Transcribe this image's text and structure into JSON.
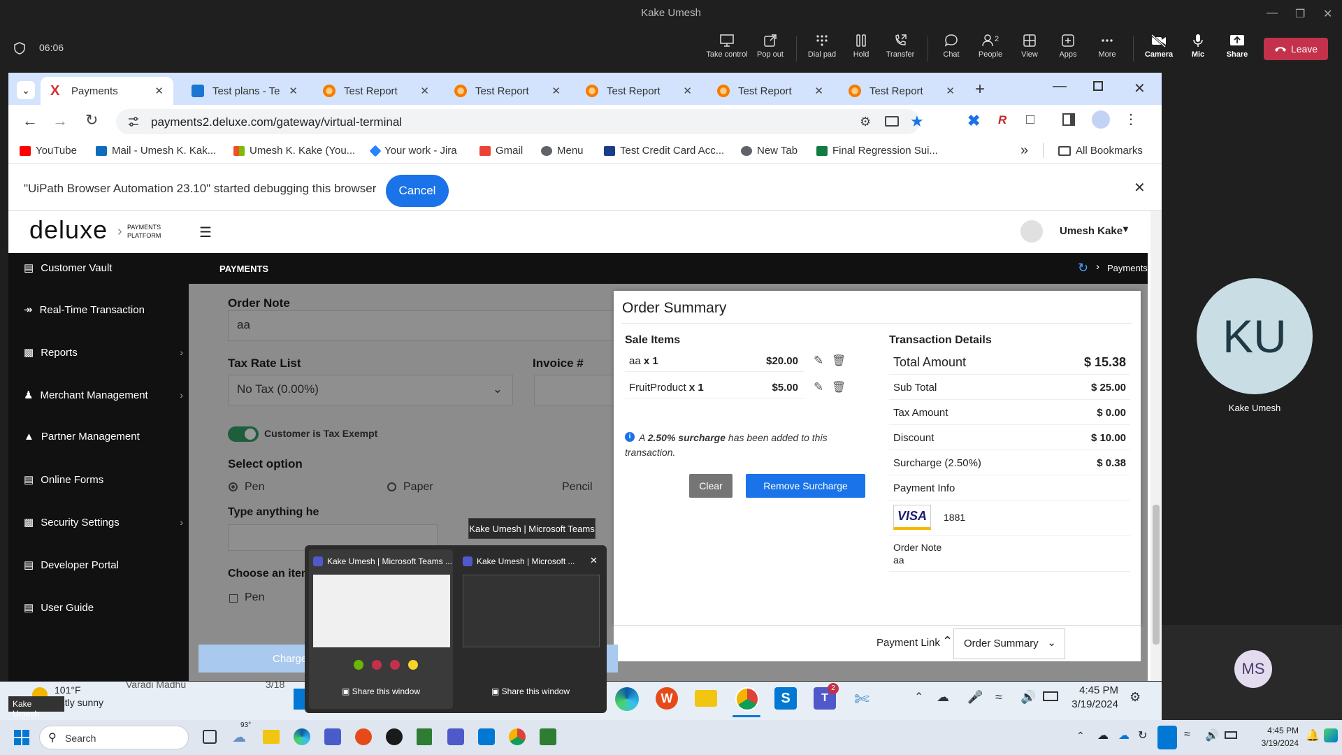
{
  "teams": {
    "window_title": "Kake Umesh",
    "timer": "06:06",
    "toolbar": [
      {
        "label": "Take control",
        "icon": "take-control-icon"
      },
      {
        "label": "Pop out",
        "icon": "pop-out-icon"
      },
      {
        "label": "Dial pad",
        "icon": "dial-pad-icon"
      },
      {
        "label": "Hold",
        "icon": "hold-icon"
      },
      {
        "label": "Transfer",
        "icon": "transfer-icon"
      },
      {
        "label": "Chat",
        "icon": "chat-icon"
      },
      {
        "label": "People",
        "icon": "people-icon"
      },
      {
        "label": "View",
        "icon": "view-icon"
      },
      {
        "label": "Apps",
        "icon": "apps-icon"
      },
      {
        "label": "More",
        "icon": "more-icon"
      },
      {
        "label": "Camera",
        "icon": "camera-off-icon"
      },
      {
        "label": "Mic",
        "icon": "mic-icon"
      },
      {
        "label": "Share",
        "icon": "share-icon"
      }
    ],
    "people_count": "2",
    "leave_label": "Leave",
    "participant_initials": "KU",
    "participant_name": "Kake Umesh",
    "participant2_initials": "MS",
    "presenter_name_tag": "Kake Umesh"
  },
  "browser": {
    "tabs": [
      {
        "title": "Payments"
      },
      {
        "title": "Test plans - Te"
      },
      {
        "title": "Test Report"
      },
      {
        "title": "Test Report"
      },
      {
        "title": "Test Report"
      },
      {
        "title": "Test Report"
      },
      {
        "title": "Test Report"
      }
    ],
    "url": "payments2.deluxe.com/gateway/virtual-terminal",
    "bookmarks": [
      {
        "label": "YouTube",
        "color": "#ff0000"
      },
      {
        "label": "Mail - Umesh K. Kak...",
        "color": "#0f6cbd"
      },
      {
        "label": "Umesh K. Kake (You...",
        "color": "#f25022"
      },
      {
        "label": "Your work - Jira",
        "color": "#2684ff"
      },
      {
        "label": "Gmail",
        "color": "#ea4335"
      },
      {
        "label": "Menu",
        "color": "#5f6368"
      },
      {
        "label": "Test Credit Card Acc...",
        "color": "#1a3c8a"
      },
      {
        "label": "New Tab",
        "color": "#5f6368"
      },
      {
        "label": "Final Regression Sui...",
        "color": "#107c41"
      }
    ],
    "all_bookmarks_label": "All Bookmarks",
    "debug_message": "\"UiPath Browser Automation 23.10\" started debugging this browser",
    "debug_cancel": "Cancel"
  },
  "app": {
    "logo": "deluxe",
    "logo_sub1": "PAYMENTS",
    "logo_sub2": "PLATFORM",
    "user_name": "Umesh Kake",
    "section_title": "PAYMENTS",
    "breadcrumb": "Payments",
    "sidebar": [
      {
        "label": "Customer Vault",
        "icon": "vault-icon",
        "has_chevron": false
      },
      {
        "label": "Real-Time Transaction",
        "icon": "realtime-icon",
        "has_chevron": false
      },
      {
        "label": "Reports",
        "icon": "reports-icon",
        "has_chevron": true
      },
      {
        "label": "Merchant Management",
        "icon": "merchant-icon",
        "has_chevron": true
      },
      {
        "label": "Partner Management",
        "icon": "partner-icon",
        "has_chevron": false
      },
      {
        "label": "Online Forms",
        "icon": "forms-icon",
        "has_chevron": false
      },
      {
        "label": "Security Settings",
        "icon": "security-icon",
        "has_chevron": true
      },
      {
        "label": "Developer Portal",
        "icon": "developer-icon",
        "has_chevron": false
      },
      {
        "label": "User Guide",
        "icon": "guide-icon",
        "has_chevron": false
      }
    ],
    "form": {
      "order_note_label": "Order Note",
      "order_note_value": "aa",
      "tax_rate_label": "Tax Rate List",
      "tax_rate_value": "No Tax (0.00%)",
      "invoice_label": "Invoice #",
      "tax_exempt_label": "Customer is Tax Exempt",
      "select_option_label": "Select option",
      "options": [
        "Pen",
        "Paper",
        "Pencil"
      ],
      "type_anything_label": "Type anything he",
      "choose_item_label": "Choose an item",
      "choose_item_first": "Pen",
      "charge_label": "Charge"
    },
    "order_summary": {
      "title": "Order Summary",
      "sale_items_label": "Sale Items",
      "items": [
        {
          "name": "aa",
          "qty": "x 1",
          "price": "$20.00"
        },
        {
          "name": "FruitProduct",
          "qty": "x 1",
          "price": "$5.00"
        }
      ],
      "surcharge_note_pre": "A ",
      "surcharge_note_bold": "2.50% surcharge",
      "surcharge_note_post": " has been added to this transaction.",
      "clear_label": "Clear",
      "remove_surcharge_label": "Remove Surcharge",
      "transaction_details_label": "Transaction Details",
      "total_amount_label": "Total Amount",
      "total_amount_value": "$ 15.38",
      "rows": [
        {
          "label": "Sub Total",
          "value": "$ 25.00"
        },
        {
          "label": "Tax Amount",
          "value": "$ 0.00"
        },
        {
          "label": "Discount",
          "value": "$ 10.00"
        },
        {
          "label": "Surcharge (2.50%)",
          "value": "$ 0.38"
        }
      ],
      "payment_info_label": "Payment Info",
      "card_brand": "VISA",
      "card_last4": "1881",
      "order_note_label": "Order Note",
      "order_note_value": "aa"
    },
    "footer": {
      "payment_link_label": "Payment Link",
      "order_summary_select": "Order Summary"
    }
  },
  "taskbar_preview": {
    "tooltip": "Kake Umesh | Microsoft Teams",
    "windows": [
      {
        "title": "Kake Umesh | Microsoft Teams ...",
        "share": "Share this window"
      },
      {
        "title": "Kake Umesh | Microsoft ...",
        "share": "Share this window"
      }
    ]
  },
  "remote_taskbar": {
    "weather_temp": "101°F",
    "weather_desc": "ostly sunny",
    "partial_name": "Varadi Madhu",
    "partial_date": "3/18",
    "time": "4:45 PM",
    "date": "3/19/2024"
  },
  "local_taskbar": {
    "search_placeholder": "Search",
    "weather_temp": "93°",
    "time": "4:45 PM",
    "date": "3/19/2024"
  }
}
